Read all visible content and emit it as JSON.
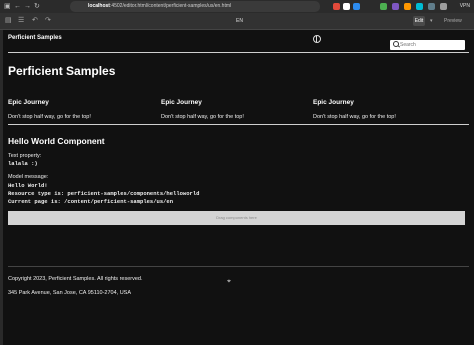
{
  "browser": {
    "url_host": "localhost",
    "url_path": ":4502/editor.html/content/perficient-samples/us/en.html",
    "vpn_label": "VPN"
  },
  "editor": {
    "language": "EN",
    "edit_label": "Edit",
    "preview_label": "Preview"
  },
  "header": {
    "brand": "Perficient Samples",
    "search_placeholder": "Search"
  },
  "main": {
    "title": "Perficient Samples",
    "teasers": [
      {
        "title": "Epic Journey",
        "text": "Don't stop half way, go for the top!"
      },
      {
        "title": "Epic Journey",
        "text": "Don't stop half way, go for the top!"
      },
      {
        "title": "Epic Journey",
        "text": "Don't stop half way, go for the top!"
      }
    ],
    "hello_world": {
      "title": "Hello World Component",
      "text_property_label": "Text property:",
      "text_property_value": "lalala :)",
      "model_message_label": "Model message:",
      "model_lines": [
        "Hello World!",
        "Resource type is: perficient-samples/components/helloworld",
        "Current page is:  /content/perficient-samples/us/en"
      ]
    },
    "drop_zone": "Drag components here"
  },
  "footer": {
    "copyright": "Copyright 2023, Perficient Samples. All rights reserved.",
    "address": "345 Park Avenue, San Jose, CA 95110-2704, USA"
  }
}
